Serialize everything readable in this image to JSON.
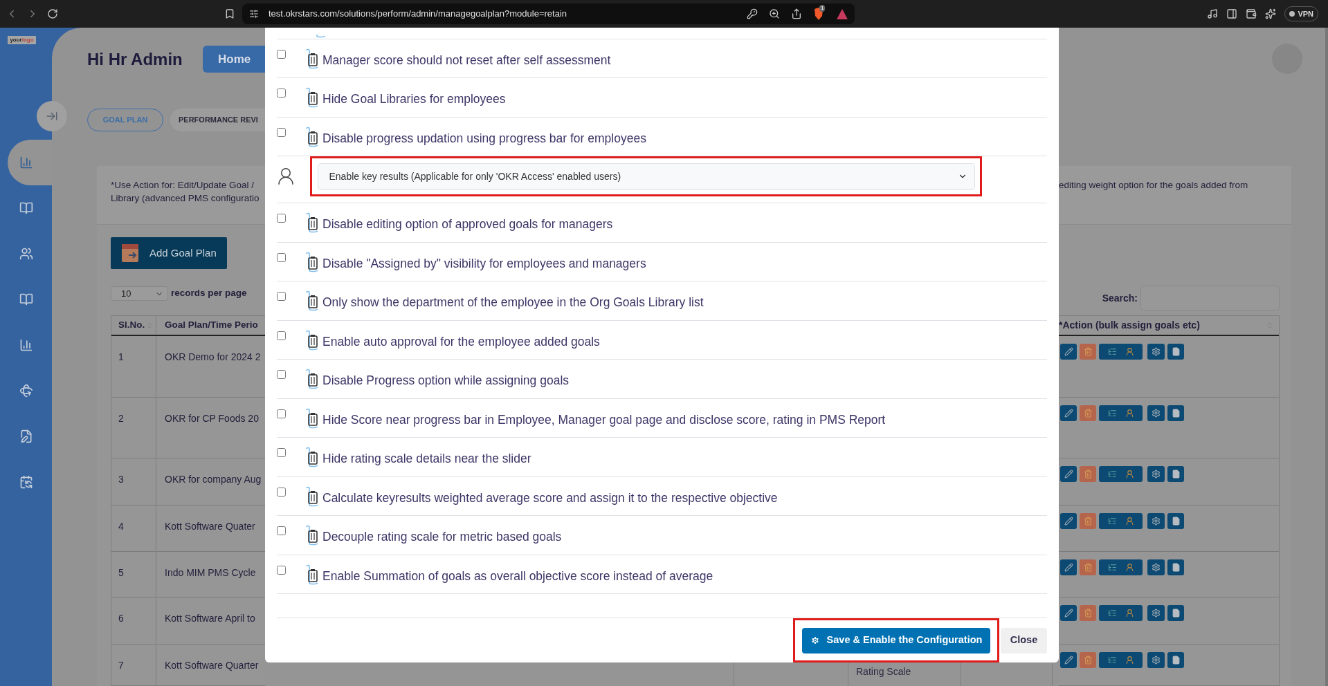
{
  "browser": {
    "url": "test.okrstars.com/solutions/perform/admin/managegoalplan?module=retain",
    "shield_badge": "1",
    "vpn": "VPN"
  },
  "sidebar": {
    "logo": {
      "word1": "your",
      "word2": "logo"
    },
    "items": [
      {
        "selected": true
      },
      {
        "selected": false
      },
      {
        "selected": false
      },
      {
        "selected": false
      },
      {
        "selected": false
      },
      {
        "selected": false
      },
      {
        "selected": false
      },
      {
        "selected": false
      }
    ]
  },
  "header": {
    "greeting": "Hi Hr Admin",
    "home_button": "Home"
  },
  "tabs": [
    {
      "label": "GOAL PLAN",
      "selected": true
    },
    {
      "label": "PERFORMANCE REVI",
      "selected": false
    }
  ],
  "note": {
    "left_lines": [
      "*Use Action for: Edit/Update Goal /",
      "Library (advanced PMS configuratio"
    ],
    "right_line": "editing weight option for the goals added from"
  },
  "add_button": "Add Goal Plan",
  "page_size": {
    "value": "10",
    "label": "records per page"
  },
  "search": {
    "label": "Search:"
  },
  "table": {
    "columns": [
      "Sl.No.",
      "Goal Plan/Time Perio",
      "*Action (bulk assign goals etc)"
    ],
    "rows": [
      {
        "sl": "1",
        "goal": "OKR Demo for 2024 2"
      },
      {
        "sl": "2",
        "goal": "OKR for CP Foods 20"
      },
      {
        "sl": "3",
        "goal": "OKR for company Aug"
      },
      {
        "sl": "4",
        "goal": "Kott Software Quater"
      },
      {
        "sl": "5",
        "goal": "Indo MIM PMS Cycle"
      },
      {
        "sl": "6",
        "goal": "Kott Software April to"
      },
      {
        "sl": "7",
        "goal": "Kott Software Quarter",
        "cell_below_dialog": "Rating Scale"
      }
    ]
  },
  "dialog": {
    "options": [
      {
        "kind": "checkbox",
        "label": "Manager score should not reset after self assessment",
        "checked": false
      },
      {
        "kind": "checkbox",
        "label": "Hide Goal Libraries for employees",
        "checked": false
      },
      {
        "kind": "checkbox",
        "label": "Disable progress updation using progress bar for employees",
        "checked": false
      },
      {
        "kind": "select",
        "value": "Enable key results (Applicable for only 'OKR Access' enabled users)",
        "highlighted": true
      },
      {
        "kind": "checkbox",
        "label": "Disable editing option of approved goals for managers",
        "checked": false
      },
      {
        "kind": "checkbox",
        "label": "Disable \"Assigned by\" visibility for employees and managers",
        "checked": false
      },
      {
        "kind": "checkbox",
        "label": "Only show the department of the employee in the Org Goals Library list",
        "checked": false
      },
      {
        "kind": "checkbox",
        "label": "Enable auto approval for the employee added goals",
        "checked": false
      },
      {
        "kind": "checkbox",
        "label": "Disable Progress option while assigning goals",
        "checked": false
      },
      {
        "kind": "checkbox",
        "label": "Hide Score near progress bar in Employee, Manager goal page and disclose score, rating in PMS Report",
        "checked": false
      },
      {
        "kind": "checkbox",
        "label": "Hide rating scale details near the slider",
        "checked": false
      },
      {
        "kind": "checkbox",
        "label": "Calculate keyresults weighted average score and assign it to the respective objective",
        "checked": false
      },
      {
        "kind": "checkbox",
        "label": "Decouple rating scale for metric based goals",
        "checked": false
      },
      {
        "kind": "checkbox",
        "label": "Enable Summation of goals as overall objective score instead of average",
        "checked": false
      }
    ],
    "save_button": {
      "label": "Save & Enable the Configuration",
      "highlighted": true
    },
    "close_button": "Close"
  }
}
